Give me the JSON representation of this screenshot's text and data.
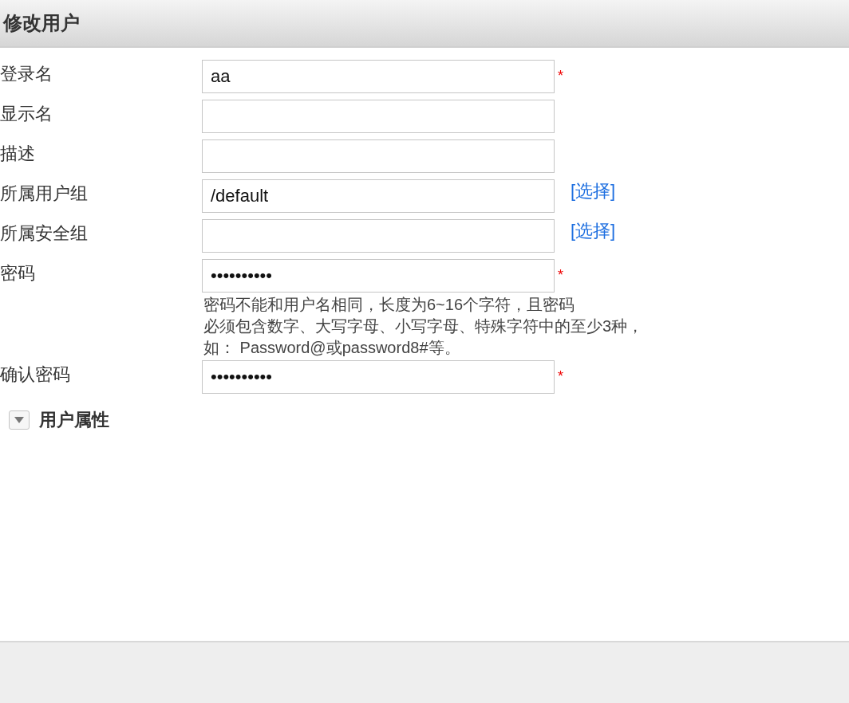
{
  "dialog": {
    "title": "修改用户"
  },
  "fields": [
    {
      "label": "登录名",
      "value": "aa",
      "required_mark": "*"
    },
    {
      "label": "显示名"
    },
    {
      "label": "描述"
    },
    {
      "label": "所属用户组",
      "value": "/default",
      "link": "[选择]"
    },
    {
      "label": "所属安全组",
      "link": "[选择]"
    },
    {
      "label": "密码",
      "value": "••••••••••",
      "required_mark": "*",
      "hint_lines": [
        "密码不能和用户名相同，长度为6~16个字符，且密码",
        "必须包含数字、大写字母、小写字母、特殊字符中的至少3种，",
        "如： Password@或password8#等。"
      ]
    },
    {
      "label": "确认密码",
      "value": "••••••••••",
      "required_mark": "*"
    }
  ],
  "section": {
    "label": "用户属性",
    "expanded": false
  }
}
